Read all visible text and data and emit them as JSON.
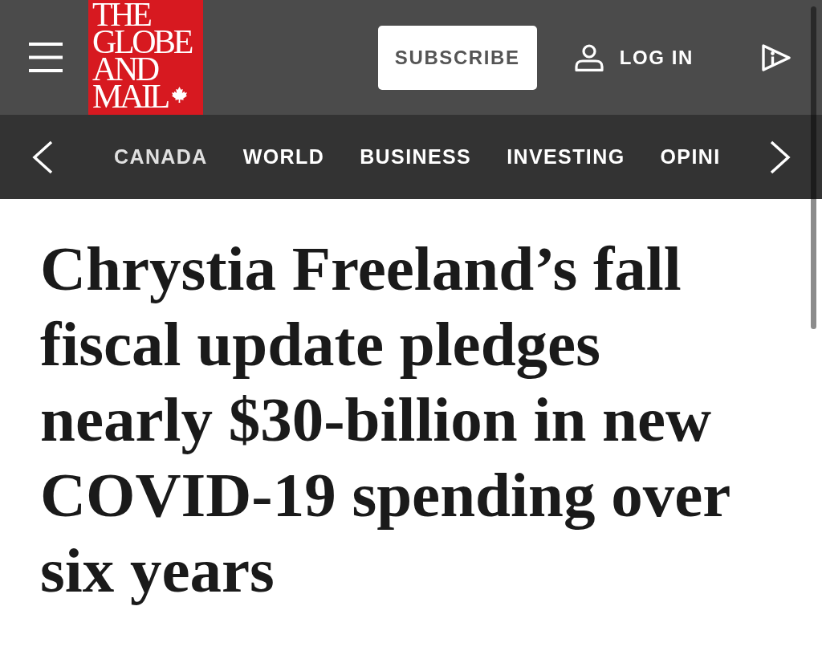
{
  "logo": {
    "lines": [
      "THE",
      "GLOBE",
      "AND",
      "MAIL"
    ]
  },
  "header": {
    "subscribe": "SUBSCRIBE",
    "login": "LOG IN"
  },
  "nav": {
    "items": [
      {
        "label": "CANADA"
      },
      {
        "label": "WORLD"
      },
      {
        "label": "BUSINESS"
      },
      {
        "label": "INVESTING"
      },
      {
        "label": "OPINI"
      }
    ]
  },
  "headline": "Chrystia Freeland’s fall fiscal update pledges nearly $30-billion in new COVID-19 spending over six years"
}
